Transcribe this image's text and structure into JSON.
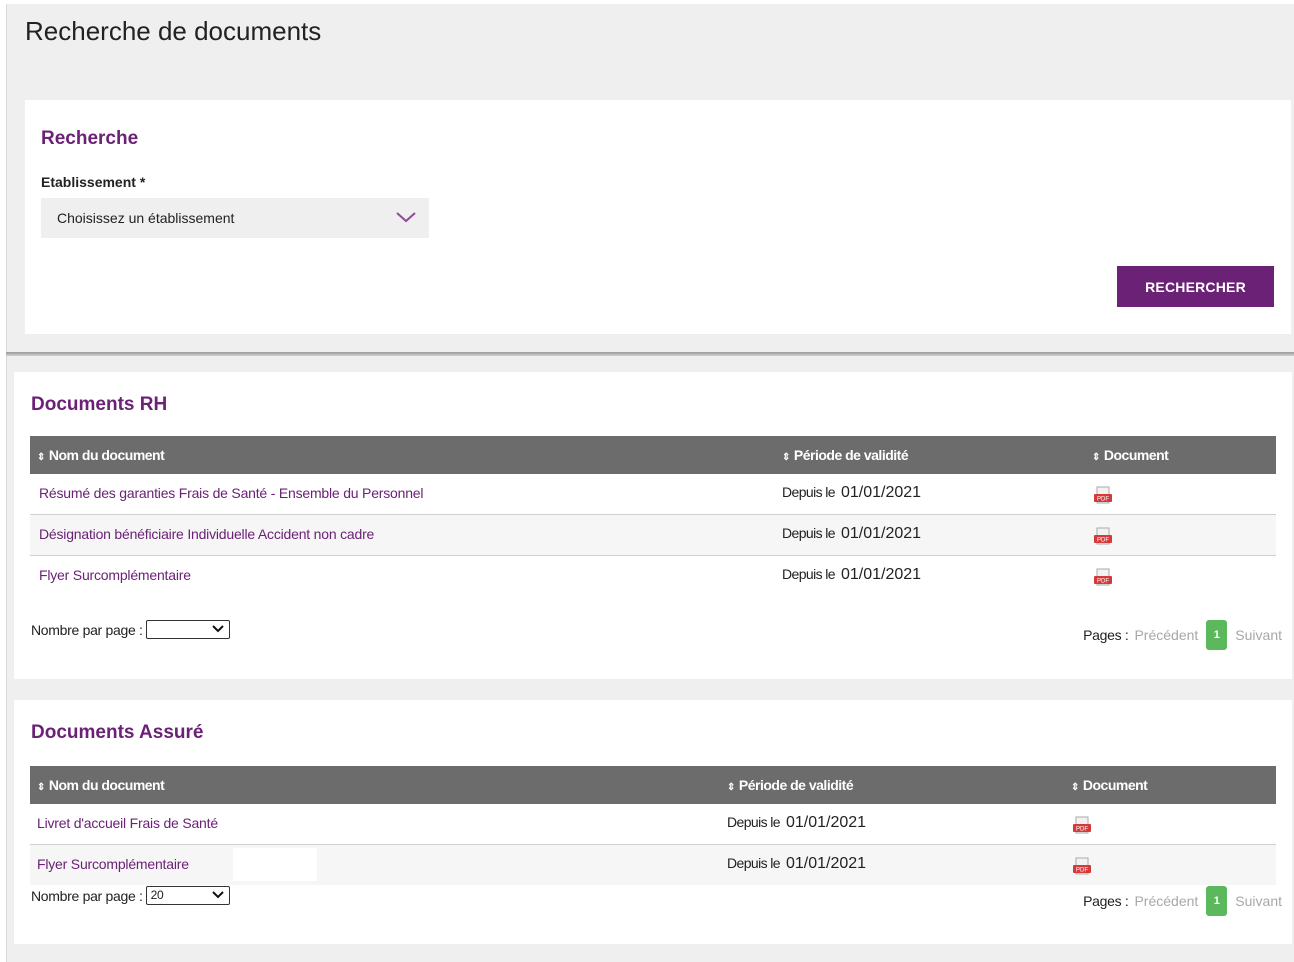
{
  "page": {
    "title": "Recherche de documents"
  },
  "search": {
    "section_title": "Recherche",
    "establishment_label": "Etablissement *",
    "establishment_value": "Choisissez un établissement",
    "button_label": "RECHERCHER"
  },
  "documents_rh": {
    "title": "Documents RH",
    "columns": [
      "Nom du document",
      "Période de validité",
      "Document"
    ],
    "rows": [
      {
        "name": "Résumé des garanties Frais de Santé - Ensemble du Personnel",
        "period_label": "Depuis le",
        "period_date": "01/01/2021",
        "doc_icon": "pdf-icon"
      },
      {
        "name": "Désignation bénéficiaire Individuelle Accident non cadre",
        "period_label": "Depuis le",
        "period_date": "01/01/2021",
        "doc_icon": "pdf-icon"
      },
      {
        "name": "Flyer Surcomplémentaire",
        "period_label": "Depuis le",
        "period_date": "01/01/2021",
        "doc_icon": "pdf-icon"
      }
    ],
    "per_page_label": "Nombre par page :",
    "per_page_value": "",
    "pages_label": "Pages :",
    "prev_label": "Précédent",
    "current_page": "1",
    "next_label": "Suivant"
  },
  "documents_assure": {
    "title": "Documents Assuré",
    "columns": [
      "Nom du document",
      "Période de validité",
      "Document"
    ],
    "rows": [
      {
        "name": "Livret d'accueil Frais de Santé",
        "period_label": "Depuis le",
        "period_date": "01/01/2021",
        "doc_icon": "pdf-icon"
      },
      {
        "name": "Flyer Surcomplémentaire",
        "period_label": "Depuis le",
        "period_date": "01/01/2021",
        "doc_icon": "pdf-icon"
      }
    ],
    "per_page_label": "Nombre par page :",
    "per_page_value": "20",
    "pages_label": "Pages :",
    "prev_label": "Précédent",
    "current_page": "1",
    "next_label": "Suivant"
  },
  "colors": {
    "brand_purple": "#6b2176",
    "table_header": "#6c6c6c",
    "page_current": "#5cb85c",
    "pdf_red": "#d33b3b"
  }
}
